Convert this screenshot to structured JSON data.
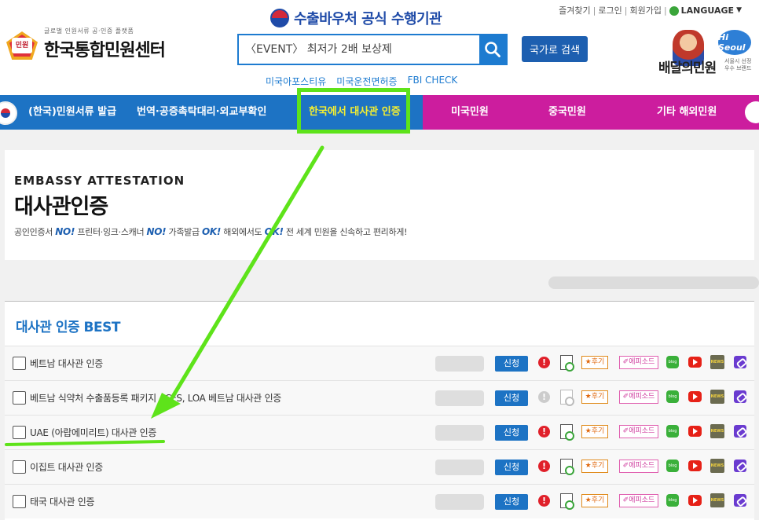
{
  "header": {
    "toplinks": [
      "즐겨찾기",
      "로그인",
      "회원가입"
    ],
    "language_label": "LANGUAGE",
    "logo": {
      "badge_text": "민원",
      "subtitle": "글로벌 인원서류 공·인증 플랫폼",
      "title": "한국통합민원센터"
    },
    "gov_title": "수출바우처 공식 수행기관",
    "search": {
      "placeholder": "〈EVENT〉 최저가 2배 보상제",
      "value": ""
    },
    "country_search_label": "국가로 검색",
    "quicklinks": [
      "미국아포스티유",
      "미국운전면허증",
      "FBI CHECK"
    ],
    "promo": {
      "title": "배달의민원",
      "badge": "Hi Seoul",
      "note": "서울시 선정 우수 브랜드"
    }
  },
  "nav": {
    "items": [
      {
        "label": "(한국)민원서류 발급"
      },
      {
        "label": "번역·공증촉탁대리·외교부확인"
      },
      {
        "label": "한국에서 대사관 인증"
      },
      {
        "label": "미국민원"
      },
      {
        "label": "중국민원"
      },
      {
        "label": "기타 해외민원"
      }
    ],
    "active_index": 2
  },
  "hero": {
    "title_en": "EMBASSY ATTESTATION",
    "title_ko": "대사관인증",
    "desc_parts": [
      "공인인증서 ",
      "NO!",
      " 프린터·잉크·스캐너 ",
      "NO!",
      " 가족발급 ",
      "OK!",
      " 해외에서도 ",
      "OK!",
      " 전 세계 민원을 신속하고 편리하게!"
    ]
  },
  "best": {
    "title": "대사관 인증 BEST",
    "apply_label": "신청",
    "alert_label": "!",
    "review_label": "★후기",
    "episode_label": "✐에피소드",
    "blog_label": "blog",
    "news_label": "NEWS",
    "rows": [
      {
        "name": "베트남 대사관 인증",
        "dim": false
      },
      {
        "name": "베트남 식약처 수출품등록 패키지 - CFS, LOA 베트남 대사관 인증",
        "dim": true
      },
      {
        "name": "UAE (아랍에미리트) 대사관 인증",
        "dim": false
      },
      {
        "name": "이집트 대사관 인증",
        "dim": false
      },
      {
        "name": "태국 대사관 인증",
        "dim": false
      }
    ]
  },
  "colors": {
    "nav_blue": "#1d73c4",
    "nav_pink": "#cc1d9e",
    "nav_active_text": "#f5ef30",
    "annotation_green": "#5ee31a",
    "apply_button": "#1d73c4"
  }
}
